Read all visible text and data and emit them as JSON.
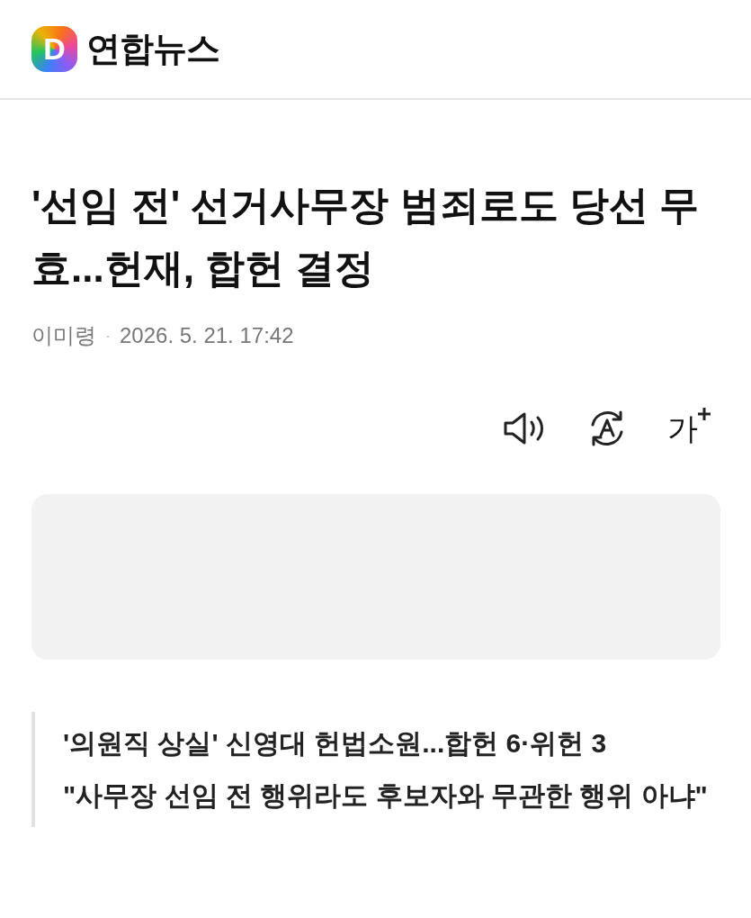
{
  "header": {
    "logo_letter": "D",
    "brand": "연합뉴스"
  },
  "article": {
    "title": "'선임 전' 선거사무장 범죄로도 당선 무효...헌재, 합헌 결정",
    "author": "이미령",
    "separator": "·",
    "datetime": "2026. 5. 21. 17:42"
  },
  "toolbar": {
    "font_size_label": "가"
  },
  "ad_area": {
    "kind": "placeholder"
  },
  "related": [
    "'의원직 상실' 신영대 헌법소원...합헌 6·위헌 3",
    "\"사무장 선임 전 행위라도 후보자와 무관한 행위 아냐\""
  ]
}
